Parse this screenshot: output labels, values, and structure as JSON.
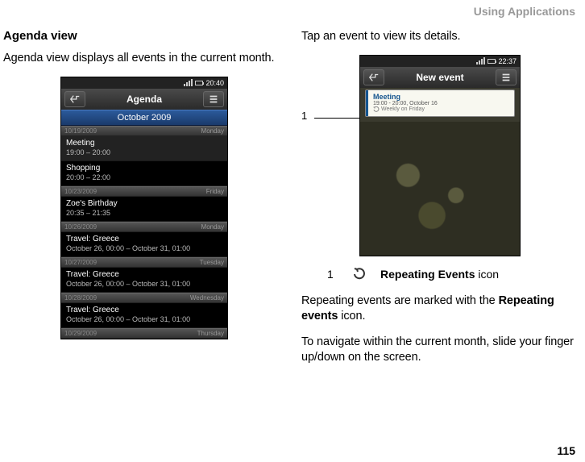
{
  "header": {
    "section": "Using Applications"
  },
  "page_number": "115",
  "left": {
    "heading": "Agenda view",
    "intro": "Agenda view displays all events in the current month.",
    "phone": {
      "status_time": "20:40",
      "titlebar": "Agenda",
      "month": "October 2009",
      "days": [
        {
          "date": "10/19/2009",
          "dow": "Monday",
          "events": [
            {
              "name": "Meeting",
              "time": "19:00 – 20:00"
            },
            {
              "name": "Shopping",
              "time": "20:00 – 22:00"
            }
          ]
        },
        {
          "date": "10/23/2009",
          "dow": "Friday",
          "events": [
            {
              "name": "Zoe's Birthday",
              "time": "20:35 – 21:35"
            }
          ]
        },
        {
          "date": "10/26/2009",
          "dow": "Monday",
          "events": [
            {
              "name": "Travel: Greece",
              "time": "October 26, 00:00 – October 31, 01:00"
            }
          ]
        },
        {
          "date": "10/27/2009",
          "dow": "Tuesday",
          "events": [
            {
              "name": "Travel: Greece",
              "time": "October 26, 00:00 – October 31, 01:00"
            }
          ]
        },
        {
          "date": "10/28/2009",
          "dow": "Wednesday",
          "events": [
            {
              "name": "Travel: Greece",
              "time": "October 26, 00:00 – October 31, 01:00"
            }
          ]
        },
        {
          "date": "10/29/2009",
          "dow": "Thursday",
          "events": []
        }
      ]
    }
  },
  "right": {
    "intro": "Tap an event to view its details.",
    "callout_num": "1",
    "phone": {
      "status_time": "22:37",
      "titlebar": "New event",
      "event": {
        "name": "Meeting",
        "time": "19:00 - 20:00, October 16",
        "repeat": "Weekly on Friday"
      }
    },
    "legend": {
      "num": "1",
      "label_bold": "Repeating Events",
      "label_rest": " icon"
    },
    "p1_a": "Repeating events are marked with the ",
    "p1_b": "Repeating events",
    "p1_c": " icon.",
    "p2": "To navigate within the current month, slide your finger up/down on the screen."
  }
}
